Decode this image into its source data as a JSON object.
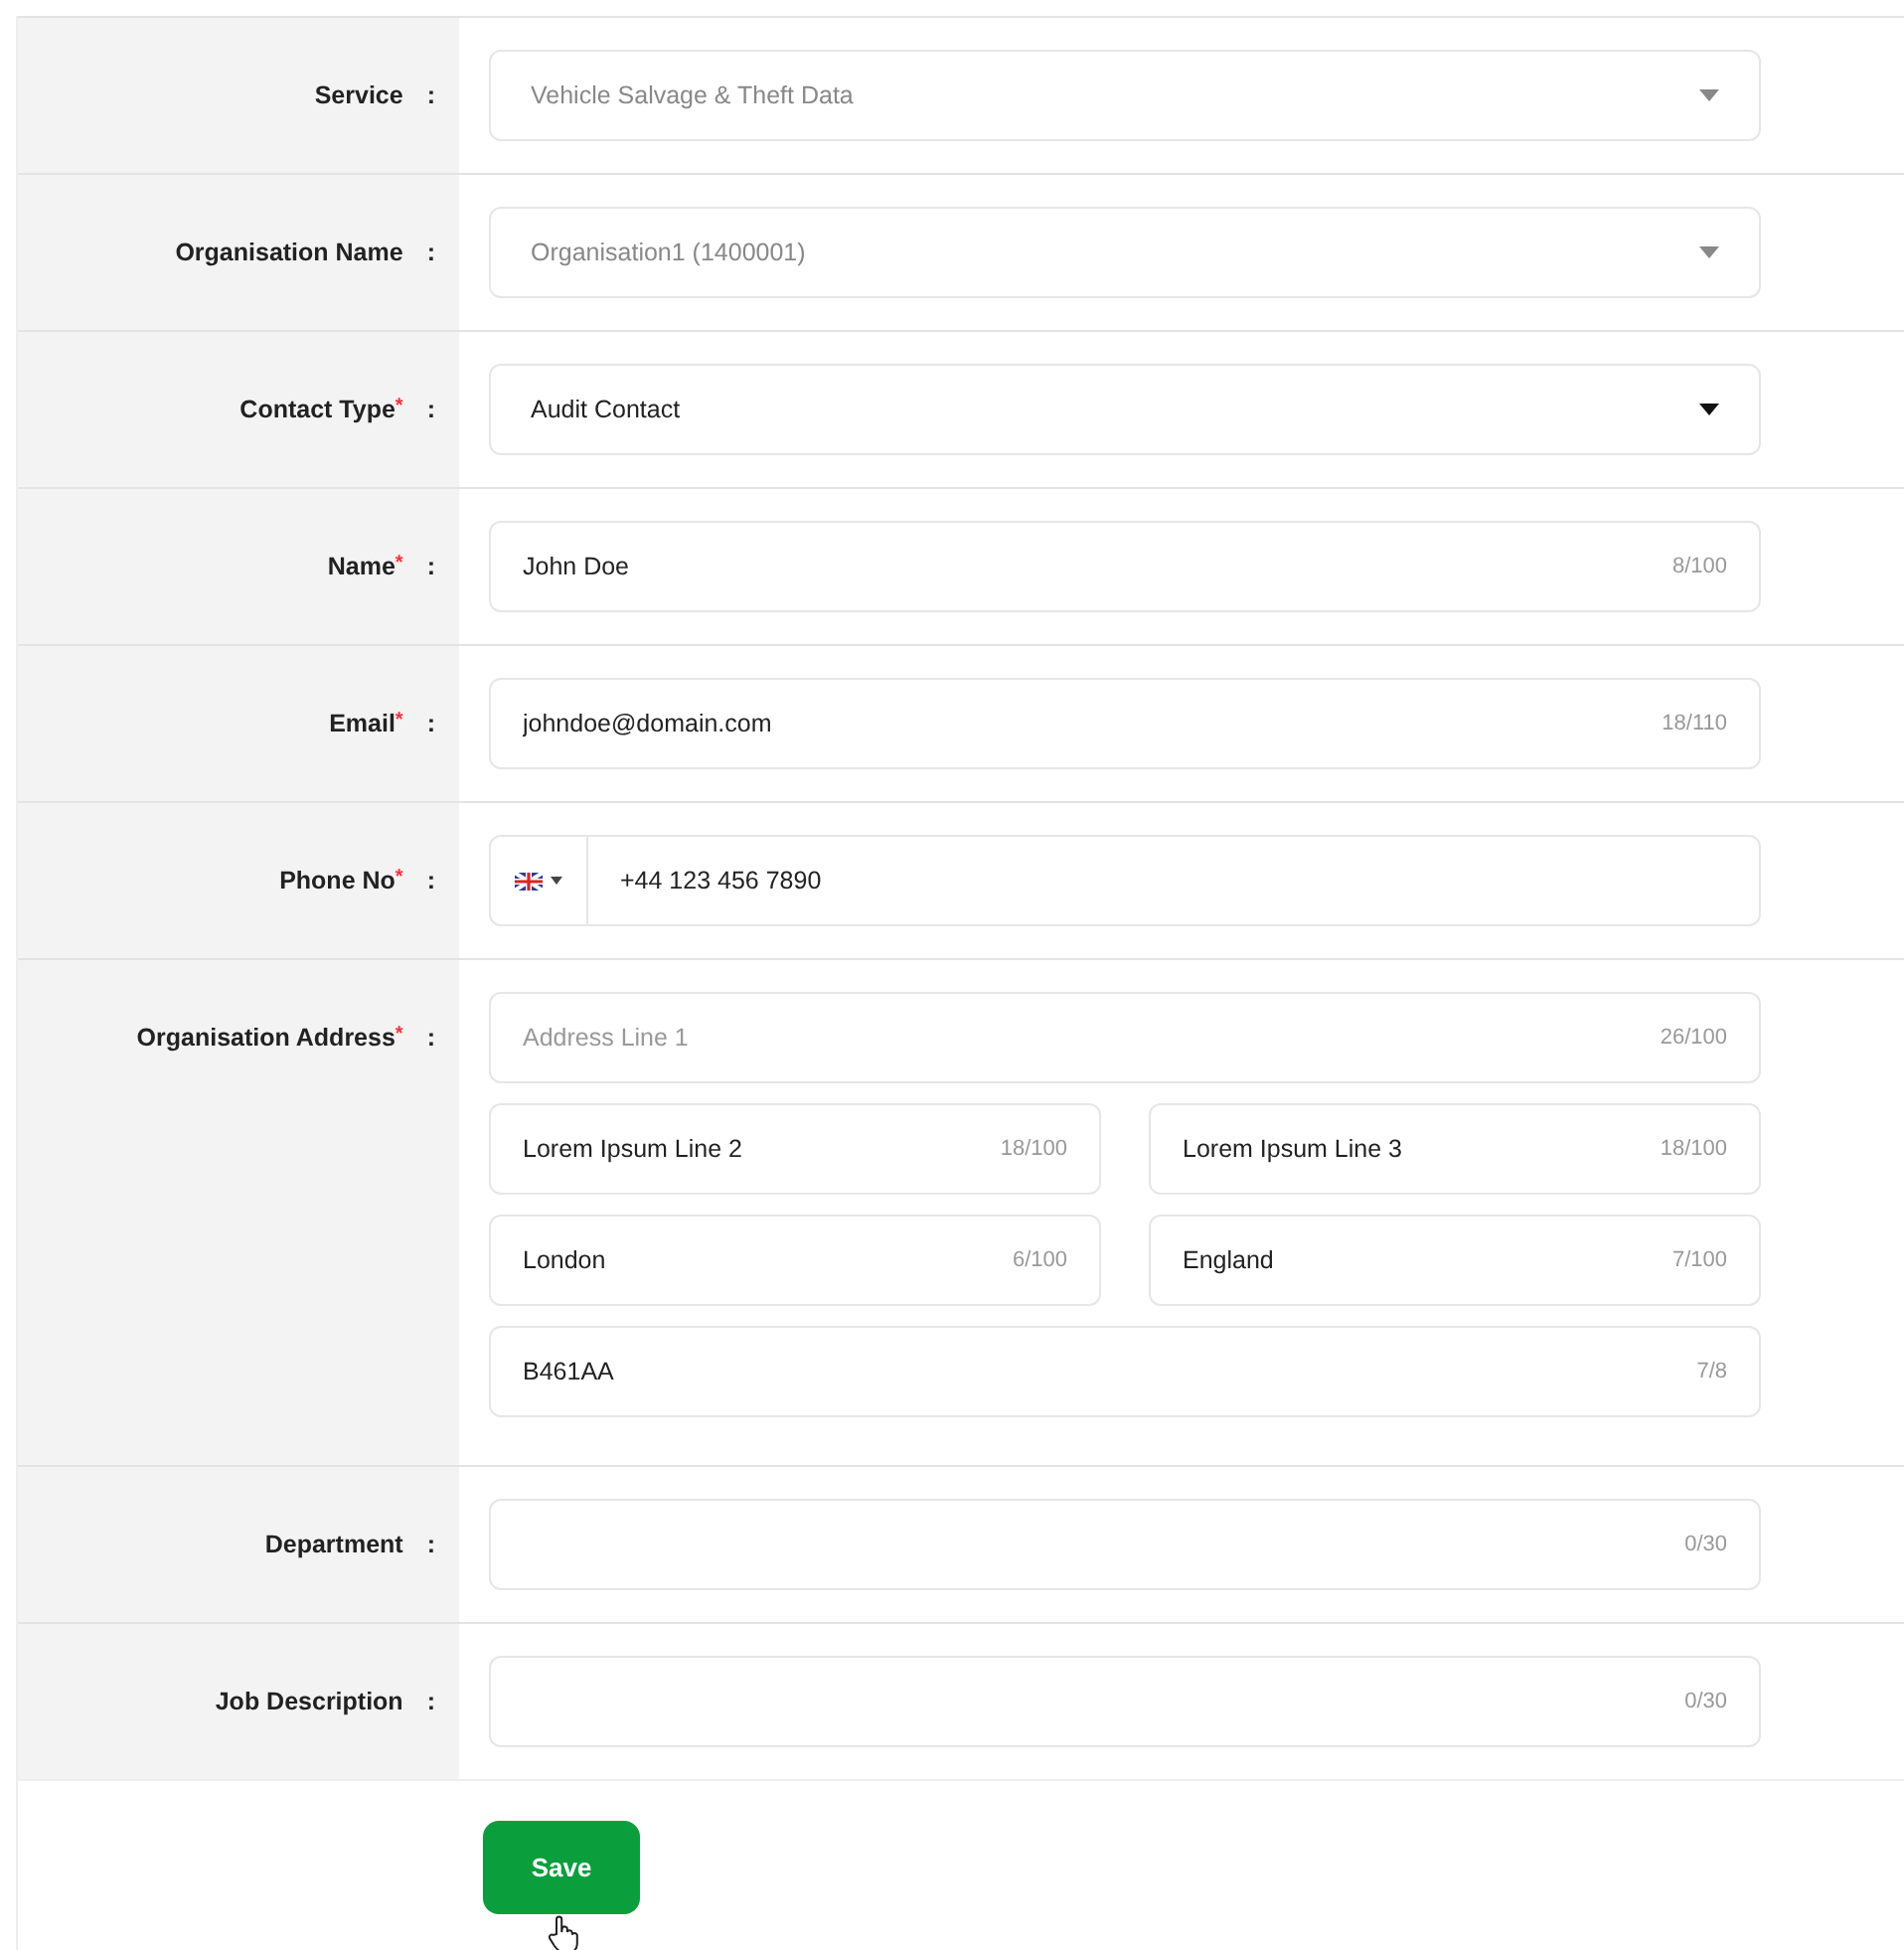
{
  "fields": [
    {
      "kind": "select",
      "label": "Service",
      "colon": ":",
      "value": "Vehicle Salvage & Theft Data",
      "disabled": true
    },
    {
      "kind": "select",
      "label": "Organisation Name",
      "colon": ":",
      "value": "Organisation1 (1400001)",
      "disabled": true
    },
    {
      "kind": "select",
      "label": "Contact Type",
      "required_mark": "*",
      "colon": ":",
      "value": "Audit Contact",
      "disabled": false
    },
    {
      "kind": "text",
      "label": "Name",
      "required_mark": "*",
      "colon": ":",
      "value": "John Doe",
      "counter": "8/100"
    },
    {
      "kind": "text",
      "label": "Email",
      "required_mark": "*",
      "colon": ":",
      "value": "johndoe@domain.com",
      "counter": "18/110"
    },
    {
      "kind": "phone",
      "label": "Phone No",
      "required_mark": "*",
      "colon": ":",
      "value": "+44 123 456 7890"
    },
    {
      "kind": "address",
      "label": "Organisation Address",
      "required_mark": "*",
      "colon": ":",
      "lines": [
        {
          "kind": "full",
          "placeholder": "Address Line 1",
          "counter": "26/100"
        },
        {
          "kind": "half",
          "value": "Lorem Ipsum Line 2",
          "counter": "18/100"
        },
        {
          "kind": "half",
          "value": "Lorem Ipsum Line 3",
          "counter": "18/100"
        },
        {
          "kind": "half",
          "value": "London",
          "counter": "6/100"
        },
        {
          "kind": "half",
          "value": "England",
          "counter": "7/100"
        },
        {
          "kind": "full",
          "value": "B461AA",
          "counter": "7/8"
        }
      ]
    },
    {
      "kind": "text",
      "label": "Department",
      "colon": ":",
      "counter": "0/30"
    },
    {
      "kind": "text",
      "label": "Job Description",
      "colon": ":",
      "counter": "0/30"
    }
  ],
  "save_button": "Save"
}
